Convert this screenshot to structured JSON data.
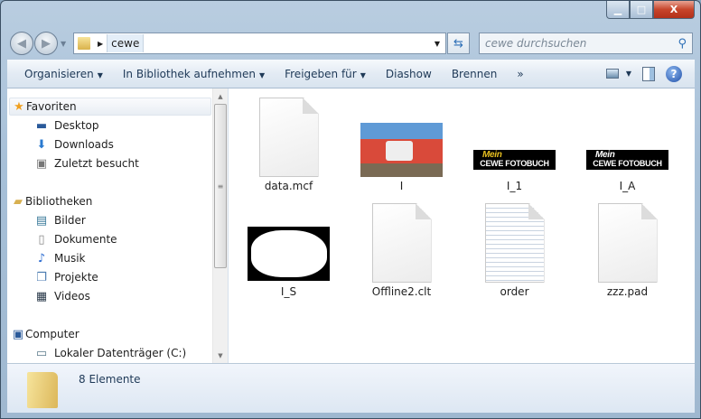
{
  "window": {
    "controls": {
      "minimize": "▁",
      "maximize": "□",
      "close": "X"
    }
  },
  "address": {
    "path": [
      "cewe"
    ],
    "search_placeholder": "cewe durchsuchen"
  },
  "toolbar": {
    "items": [
      "Organisieren",
      "In Bibliothek aufnehmen",
      "Freigeben für",
      "Diashow",
      "Brennen"
    ],
    "more": "»"
  },
  "sidebar": {
    "favorites": {
      "label": "Favoriten",
      "items": [
        "Desktop",
        "Downloads",
        "Zuletzt besucht"
      ]
    },
    "libraries": {
      "label": "Bibliotheken",
      "items": [
        "Bilder",
        "Dokumente",
        "Musik",
        "Projekte",
        "Videos"
      ]
    },
    "computer": {
      "label": "Computer",
      "items": [
        "Lokaler Datenträger (C:)"
      ]
    }
  },
  "files": [
    {
      "name": "data.mcf",
      "type": "document"
    },
    {
      "name": "I",
      "type": "photo"
    },
    {
      "name": "I_1",
      "type": "logo",
      "logo_text": [
        "Mein",
        "CEWE FOTOBUCH"
      ]
    },
    {
      "name": "I_A",
      "type": "logo",
      "logo_text": [
        "Mein",
        "CEWE FOTOBUCH"
      ]
    },
    {
      "name": "I_S",
      "type": "mask"
    },
    {
      "name": "Offline2.clt",
      "type": "document"
    },
    {
      "name": "order",
      "type": "text"
    },
    {
      "name": "zzz.pad",
      "type": "document"
    }
  ],
  "status": {
    "count": "8 Elemente"
  }
}
